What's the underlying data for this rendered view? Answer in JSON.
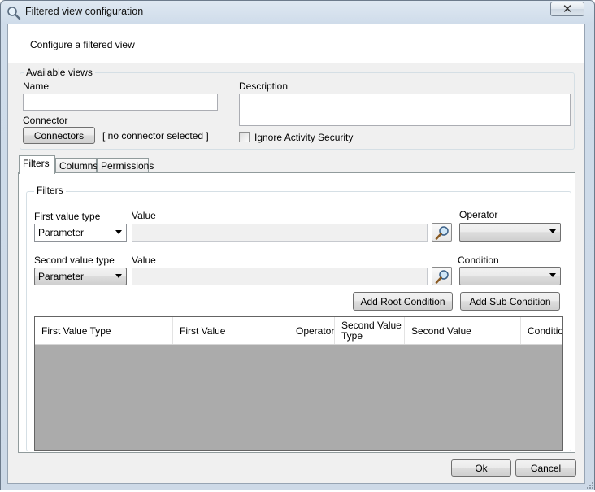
{
  "window": {
    "title": "Filtered view configuration",
    "close_glyph": "✕"
  },
  "header": {
    "subtitle": "Configure a filtered view"
  },
  "available_views": {
    "legend": "Available views",
    "name_label": "Name",
    "name_value": "",
    "description_label": "Description",
    "description_value": "",
    "connector_label": "Connector",
    "connectors_button": "Connectors",
    "connector_status": "[ no connector selected ]",
    "ignore_security_label": "Ignore Activity Security",
    "ignore_security_checked": false
  },
  "tabs": [
    {
      "label": "Filters",
      "active": true
    },
    {
      "label": "Columns",
      "active": false
    },
    {
      "label": "Permissions",
      "active": false
    }
  ],
  "filters": {
    "legend": "Filters",
    "first_value_type_label": "First value type",
    "first_value_type": "Parameter",
    "first_value_label": "Value",
    "first_value": "",
    "operator_label": "Operator",
    "operator_value": "",
    "second_value_type_label": "Second value type",
    "second_value_type": "Parameter",
    "second_value_label": "Value",
    "second_value": "",
    "condition_label": "Condition",
    "condition_value": "",
    "add_root_button": "Add Root Condition",
    "add_sub_button": "Add Sub Condition"
  },
  "grid": {
    "columns": [
      "First Value Type",
      "First Value",
      "Operator",
      "Second Value Type",
      "Second Value",
      "Conditio"
    ],
    "rows": []
  },
  "footer": {
    "ok_button": "Ok",
    "cancel_button": "Cancel"
  },
  "icons": {
    "title": "magnifier-icon",
    "search": "magnifier-icon",
    "close": "close-icon",
    "grip": "resize-grip-icon"
  }
}
